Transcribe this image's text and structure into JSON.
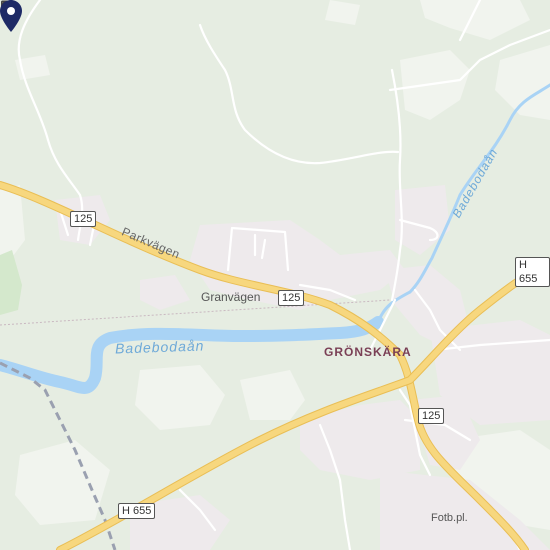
{
  "map": {
    "place_labels": {
      "town": "GRÖNSKÄRA",
      "stop": "Granvägen",
      "sports": "Fotb.pl."
    },
    "road_labels": {
      "street": "Parkvägen"
    },
    "water_labels": {
      "river_lower": "Badebodaån",
      "river_upper": "Badebodaån"
    },
    "shields": {
      "west": "125",
      "center": "125",
      "south": "125",
      "east": "H 655",
      "southwest": "H 655"
    },
    "icons": {
      "marker": "location-pin-icon",
      "bus": "bus-stop-icon",
      "sports": "football-pitch-icon"
    },
    "colors": {
      "land": "#e6ede2",
      "urban": "#eeeaec",
      "forest_light": "#f1f4ee",
      "park": "#d4e8cc",
      "water": "#a9d3f5",
      "main_road": "#f7d77e",
      "road_edge": "#e9be55",
      "minor_road": "#ffffff",
      "railway": "#9aa0b0",
      "marker": "#1e2a66"
    }
  }
}
